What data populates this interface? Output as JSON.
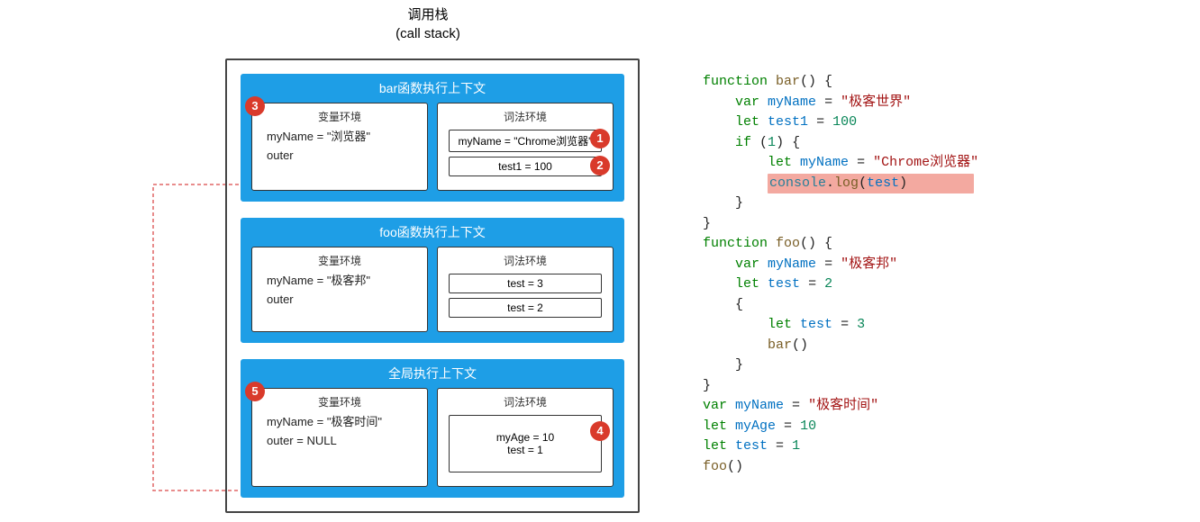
{
  "title": {
    "zh": "调用栈",
    "en": "(call stack)"
  },
  "contexts": [
    {
      "title": "bar函数执行上下文",
      "var_env": {
        "label": "变量环境",
        "lines": [
          "myName = \"浏览器\"",
          "outer"
        ]
      },
      "lex_env": {
        "label": "词法环境",
        "slots": [
          "myName = \"Chrome浏览器\"",
          "test1 = 100"
        ]
      },
      "badges": {
        "b3": "3",
        "b1": "1",
        "b2": "2"
      }
    },
    {
      "title": "foo函数执行上下文",
      "var_env": {
        "label": "变量环境",
        "lines": [
          "myName = \"极客邦\"",
          "outer"
        ]
      },
      "lex_env": {
        "label": "词法环境",
        "slots": [
          "test = 3",
          "test = 2"
        ]
      },
      "badges": {}
    },
    {
      "title": "全局执行上下文",
      "var_env": {
        "label": "变量环境",
        "lines": [
          "myName = \"极客时间\"",
          "outer = NULL"
        ]
      },
      "lex_env": {
        "label": "词法环境",
        "slots": [
          "myAge = 10\ntest = 1"
        ]
      },
      "badges": {
        "b5": "5",
        "b4": "4"
      }
    }
  ],
  "code": {
    "l1_kw": "function",
    "l1_fn": "bar",
    "l1_tail": "() {",
    "l2_kw": "var",
    "l2_var": "myName",
    "l2_eq": " = ",
    "l2_str": "\"极客世界\"",
    "l3_kw": "let",
    "l3_var": "test1",
    "l3_eq": " = ",
    "l3_num": "100",
    "l4_kw": "if",
    "l4_open": " (",
    "l4_num": "1",
    "l4_close": ") {",
    "l5_kw": "let",
    "l5_var": "myName",
    "l5_eq": " = ",
    "l5_str": "\"Chrome浏览器\"",
    "l6_obj": "console",
    "l6_dot": ".",
    "l6_fn": "log",
    "l6_open": "(",
    "l6_arg": "test",
    "l6_close": ")",
    "l7_brace": "}",
    "l8_brace": "}",
    "l9_kw": "function",
    "l9_fn": "foo",
    "l9_tail": "() {",
    "l10_kw": "var",
    "l10_var": "myName",
    "l10_eq": " = ",
    "l10_str": "\"极客邦\"",
    "l11_kw": "let",
    "l11_var": "test",
    "l11_eq": " = ",
    "l11_num": "2",
    "l12_brace": "{",
    "l13_kw": "let",
    "l13_var": "test",
    "l13_eq": " = ",
    "l13_num": "3",
    "l14_fn": "bar",
    "l14_call": "()",
    "l15_brace": "}",
    "l16_brace": "}",
    "l17_kw": "var",
    "l17_var": "myName",
    "l17_eq": " = ",
    "l17_str": "\"极客时间\"",
    "l18_kw": "let",
    "l18_var": "myAge",
    "l18_eq": " = ",
    "l18_num": "10",
    "l19_kw": "let",
    "l19_var": "test",
    "l19_eq": " = ",
    "l19_num": "1",
    "l20_fn": "foo",
    "l20_call": "()"
  }
}
